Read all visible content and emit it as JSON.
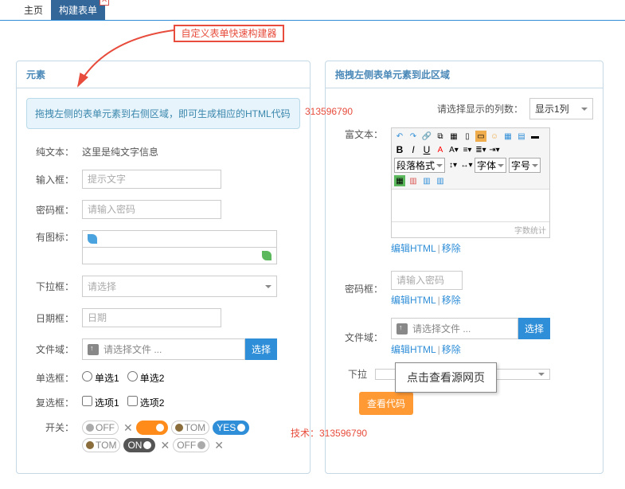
{
  "tabs": {
    "home": "主页",
    "build": "构建表单"
  },
  "annotation": "自定义表单快速构建器",
  "tech_label": "技术：313596790",
  "left": {
    "title": "元素",
    "hint": "拖拽左侧的表单元素到右侧区域，即可生成相应的HTML代码",
    "plaintext_lbl": "纯文本：",
    "plaintext_val": "这里是纯文字信息",
    "input_lbl": "输入框：",
    "input_ph": "提示文字",
    "password_lbl": "密码框：",
    "password_ph": "请输入密码",
    "icon_lbl": "有图标：",
    "select_lbl": "下拉框：",
    "select_ph": "请选择",
    "date_lbl": "日期框：",
    "date_ph": "日期",
    "file_lbl": "文件域：",
    "file_txt": "请选择文件 ...",
    "file_btn": "选择",
    "radio_lbl": "单选框：",
    "radio1": "单选1",
    "radio2": "单选2",
    "check_lbl": "复选框：",
    "check1": "选项1",
    "check2": "选项2",
    "switch_lbl": "开关：",
    "sw": {
      "off": "OFF",
      "on": "ON",
      "tom": "TOM",
      "yes": "YES"
    }
  },
  "right": {
    "title": "拖拽左侧表单元素到此区域",
    "cols_lbl": "请选择显示的列数：",
    "cols_val": "显示1列",
    "rich_lbl": "富文本：",
    "tb_fmt": "段落格式",
    "tb_font": "字体",
    "tb_size": "字号",
    "stats": "字数统计",
    "edit_html": "编辑HTML",
    "delete": "移除",
    "password_lbl": "密码框：",
    "password_ph": "请输入密码",
    "file_lbl": "文件域：",
    "file_txt": "请选择文件 ...",
    "file_btn": "选择",
    "select_lbl": "下拉",
    "popup": "点击查看源网页",
    "view_code": "查看代码"
  }
}
